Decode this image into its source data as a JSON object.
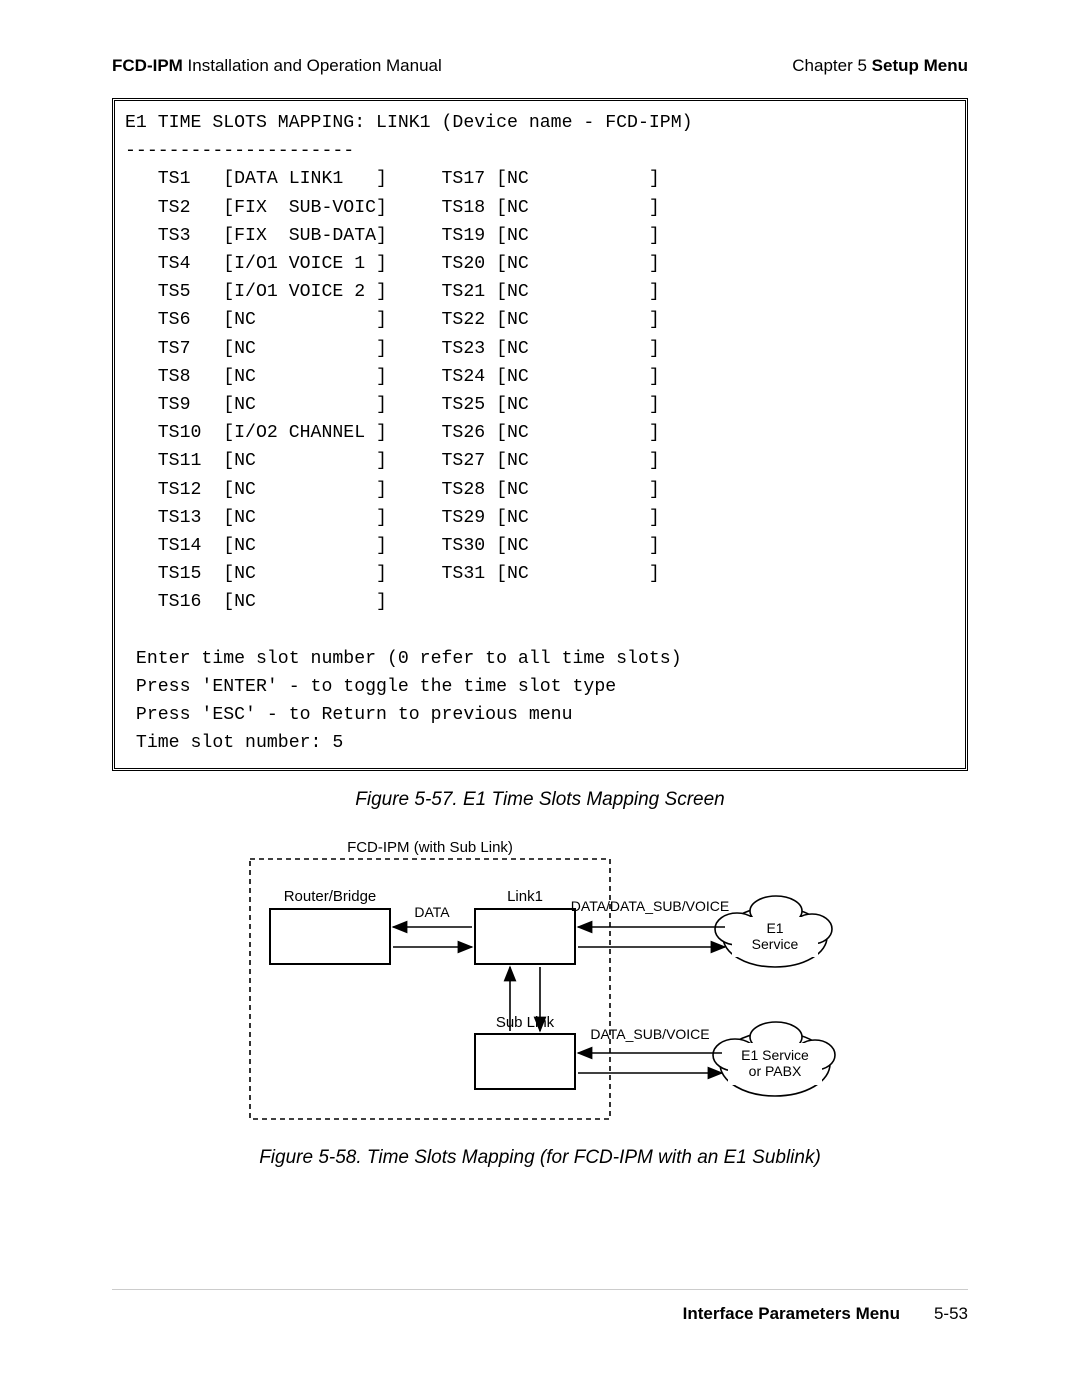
{
  "header": {
    "product": "FCD-IPM",
    "doc": " Installation and Operation Manual",
    "chapterLabel": "Chapter 5  ",
    "chapterName": "Setup Menu"
  },
  "screen": {
    "title": "E1 TIME SLOTS MAPPING: LINK1 (Device name - FCD-IPM)",
    "instr1": "Enter time slot number (0 refer to all time slots)",
    "instr2": "Press 'ENTER' - to toggle the time slot type",
    "instr3": "Press 'ESC' - to Return to previous menu",
    "promptLabel": "Time slot number:",
    "promptValue": "5"
  },
  "slotsLeft": [
    {
      "n": "TS1",
      "v": "DATA LINK1   "
    },
    {
      "n": "TS2",
      "v": "FIX  SUB-VOICE"
    },
    {
      "n": "TS3",
      "v": "FIX  SUB-DATA "
    },
    {
      "n": "TS4",
      "v": "I/O1 VOICE 1 "
    },
    {
      "n": "TS5",
      "v": "I/O1 VOICE 2 "
    },
    {
      "n": "TS6",
      "v": "NC           "
    },
    {
      "n": "TS7",
      "v": "NC           "
    },
    {
      "n": "TS8",
      "v": "NC           "
    },
    {
      "n": "TS9",
      "v": "NC           "
    },
    {
      "n": "TS10",
      "v": "I/O2 CHANNEL "
    },
    {
      "n": "TS11",
      "v": "NC           "
    },
    {
      "n": "TS12",
      "v": "NC           "
    },
    {
      "n": "TS13",
      "v": "NC           "
    },
    {
      "n": "TS14",
      "v": "NC           "
    },
    {
      "n": "TS15",
      "v": "NC           "
    },
    {
      "n": "TS16",
      "v": "NC           "
    }
  ],
  "slotsRight": [
    {
      "n": "TS17",
      "v": "NC           "
    },
    {
      "n": "TS18",
      "v": "NC           "
    },
    {
      "n": "TS19",
      "v": "NC           "
    },
    {
      "n": "TS20",
      "v": "NC           "
    },
    {
      "n": "TS21",
      "v": "NC           "
    },
    {
      "n": "TS22",
      "v": "NC           "
    },
    {
      "n": "TS23",
      "v": "NC           "
    },
    {
      "n": "TS24",
      "v": "NC           "
    },
    {
      "n": "TS25",
      "v": "NC           "
    },
    {
      "n": "TS26",
      "v": "NC           "
    },
    {
      "n": "TS27",
      "v": "NC           "
    },
    {
      "n": "TS28",
      "v": "NC           "
    },
    {
      "n": "TS29",
      "v": "NC           "
    },
    {
      "n": "TS30",
      "v": "NC           "
    },
    {
      "n": "TS31",
      "v": "NC           "
    }
  ],
  "figA": "Figure 5-57.  E1 Time Slots Mapping Screen",
  "figB": "Figure 5-58.  Time Slots Mapping (for FCD-IPM with an E1 Sublink)",
  "diagram": {
    "title": "FCD-IPM (with Sub Link)",
    "router": "Router/Bridge",
    "data": "DATA",
    "link1": "Link1",
    "sublink": "Sub Link",
    "top": "DATA/DATA_SUB/VOICE",
    "bottom": "DATA_SUB/VOICE",
    "cloud1a": "E1",
    "cloud1b": "Service",
    "cloud2a": "E1 Service",
    "cloud2b": "or PABX"
  },
  "footer": {
    "title": "Interface Parameters Menu",
    "page": "5-53"
  }
}
